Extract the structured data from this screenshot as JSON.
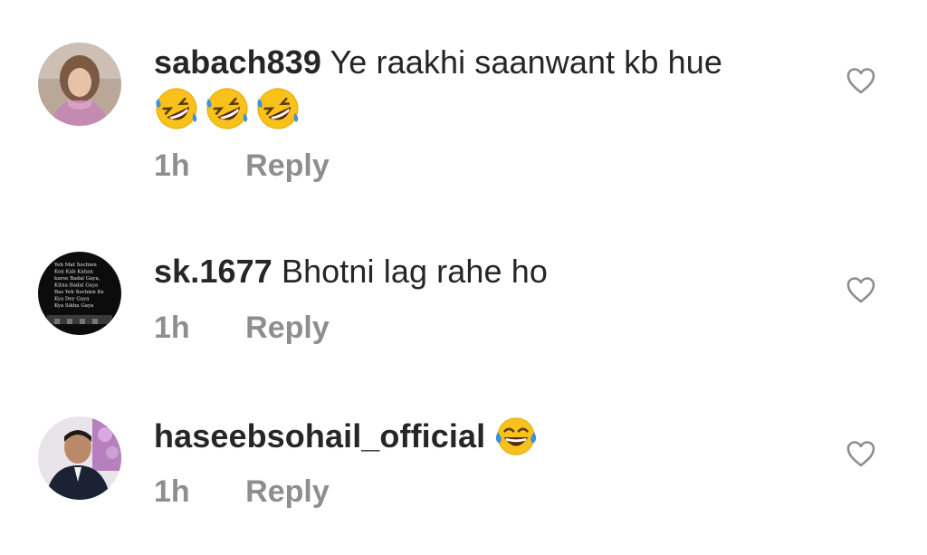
{
  "comments": [
    {
      "username": "sabach839",
      "text": "Ye raakhi saanwant kb hue",
      "emojis": [
        "rolling-on-floor-laughing",
        "rolling-on-floor-laughing",
        "rolling-on-floor-laughing"
      ],
      "time": "1h",
      "reply_label": "Reply"
    },
    {
      "username": "sk.1677",
      "text": "Bhotni lag rahe ho",
      "avatar_text": [
        "Yeh Mat Sochien",
        "Kon Kab Kahan",
        "karse Badal Gaya,",
        "Kitna Badal Gaya",
        "Bas Yeh Sochien Ke",
        "Kya Dey Gaya",
        "Kya Sikha Gaya"
      ],
      "time": "1h",
      "reply_label": "Reply"
    },
    {
      "username": "haseebsohail_official",
      "text": "",
      "emojis": [
        "face-with-tears-of-joy"
      ],
      "time": "1h",
      "reply_label": "Reply"
    }
  ],
  "colors": {
    "text": "#262626",
    "secondary_text": "#8e8e8e",
    "emoji_yellow": "#f9c21b",
    "emoji_tear_blue": "#3d8fe0"
  },
  "icons": {
    "like": "heart-outline-icon"
  }
}
